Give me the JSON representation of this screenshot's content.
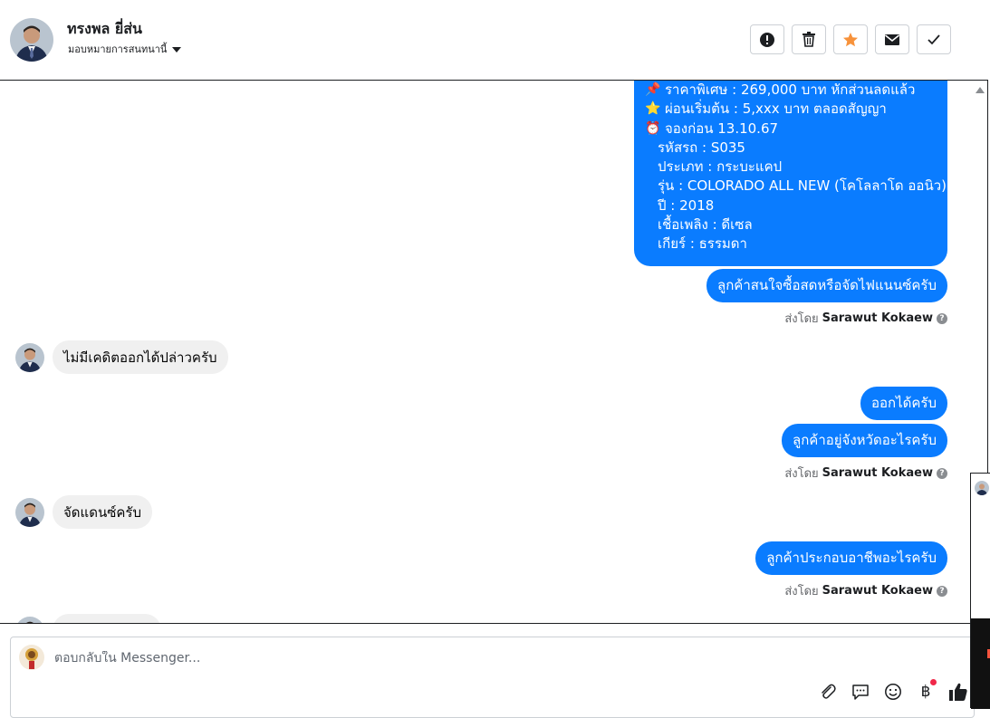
{
  "header": {
    "name": "ทรงพล ยี่ส่น",
    "assignment": "มอบหมายการสนทนานี้",
    "actions": [
      {
        "icon": "exclamation-circle-icon",
        "kind": "alert"
      },
      {
        "icon": "trash-icon",
        "kind": "delete"
      },
      {
        "icon": "star-icon",
        "kind": "star"
      },
      {
        "icon": "envelope-icon",
        "kind": "mail"
      },
      {
        "icon": "checkmark-icon",
        "kind": "done"
      }
    ],
    "star_color": "#f7923b"
  },
  "messages": {
    "details": [
      {
        "icon": "📌",
        "text": "ราคาพิเศษ : 269,000 บาท หักส่วนลดแล้ว"
      },
      {
        "icon": "⭐",
        "text": "ผ่อนเริ่มต้น : 5,xxx บาท ตลอดสัญญา"
      },
      {
        "icon": "⏰",
        "text": "จองก่อน 13.10.67"
      },
      {
        "text": "รหัสรถ : S035"
      },
      {
        "text": "ประเภท : กระบะแคป"
      },
      {
        "text": "รุ่น : COLORADO ALL NEW (โคโลลาโด ออนิว)"
      },
      {
        "text": "ปี : 2018"
      },
      {
        "text": "เชื้อเพลิง : ดีเซล"
      },
      {
        "text": "เกียร์ : ธรรมดา"
      }
    ],
    "out1": "ลูกค้าสนใจซื้อสดหรือจัดไฟแนนซ์ครับ",
    "sent_by_label": "ส่งโดย",
    "sender": "Sarawut Kokaew",
    "in1": "ไม่มีเคดิตออกได้ปล่าวครับ",
    "out2": "ออกได้ครับ",
    "out3": "ลูกค้าอยู่จังหวัดอะไรครับ",
    "in2": "จัดแดนซ์ครับ",
    "out4": "ลูกค้าประกอบอาชีพอะไรครับ"
  },
  "composer": {
    "placeholder": "ตอบกลับใน Messenger...",
    "tools": [
      "paperclip-icon",
      "chat-bubble-icon",
      "smiley-icon",
      "baht-icon",
      "thumbs-up-icon"
    ]
  },
  "colors": {
    "outgoing_bubble": "#0a7cff",
    "incoming_bubble": "#f0f0f0",
    "badge": "#f02849"
  }
}
